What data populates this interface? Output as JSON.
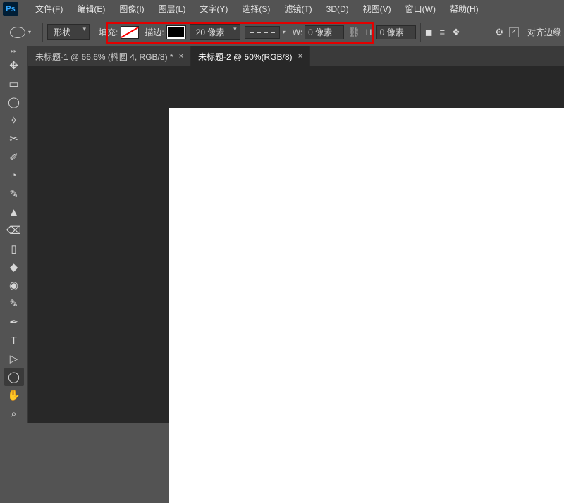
{
  "app": {
    "logo": "Ps"
  },
  "menu": {
    "items": [
      "文件(F)",
      "编辑(E)",
      "图像(I)",
      "图层(L)",
      "文字(Y)",
      "选择(S)",
      "滤镜(T)",
      "3D(D)",
      "视图(V)",
      "窗口(W)",
      "帮助(H)"
    ]
  },
  "options": {
    "shape_mode": "形状",
    "fill_label": "填充:",
    "stroke_label": "描边:",
    "stroke_size": "20 像素",
    "w_label": "W:",
    "w_value": "0 像素",
    "h_label": "H:",
    "h_value": "0 像素",
    "align_label": "对齐边缘",
    "checkbox_mark": "✓"
  },
  "tabs": {
    "items": [
      {
        "label": "未标题-1 @ 66.6% (椭圆 4, RGB/8) *",
        "active": false
      },
      {
        "label": "未标题-2 @ 50%(RGB/8)",
        "active": true
      }
    ],
    "close": "×"
  },
  "tools": {
    "glyphs": [
      "✥",
      "▭",
      "◯",
      "✧",
      "✂",
      "✐",
      "◔",
      "✎",
      "▲",
      "⌫",
      "▯",
      "◆",
      "◉",
      "✎",
      "✒",
      "T",
      "▷",
      "◯",
      "✋",
      "⌕"
    ],
    "names": [
      "move",
      "marquee",
      "lasso",
      "magic-wand",
      "crop",
      "eyedropper",
      "healing",
      "brush",
      "clone",
      "eraser",
      "gradient",
      "blur",
      "dodge",
      "pen",
      "path-select",
      "text",
      "direct-select",
      "ellipse",
      "hand",
      "zoom"
    ],
    "selected_index": 17
  }
}
